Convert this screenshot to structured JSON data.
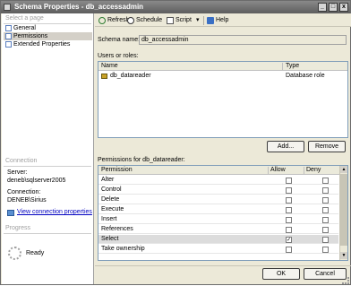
{
  "window": {
    "title": "Schema Properties - db_accessadmin",
    "minimize": "_",
    "maximize": "□",
    "close": "x"
  },
  "left": {
    "select_page_title": "Select a page",
    "pages": [
      {
        "label": "General"
      },
      {
        "label": "Permissions"
      },
      {
        "label": "Extended Properties"
      }
    ],
    "connection_title": "Connection",
    "server_label": "Server:",
    "server_value": "deneb\\sqlserver2005",
    "connection_label": "Connection:",
    "connection_value": "DENEB\\Sirius",
    "view_link": "View connection properties",
    "progress_title": "Progress",
    "status": "Ready"
  },
  "toolbar": {
    "refresh": "Refresh",
    "schedule": "Schedule",
    "script": "Script",
    "dropdown": "▾",
    "help": "Help"
  },
  "main": {
    "schema_name_label": "Schema name:",
    "schema_name_value": "db_accessadmin",
    "users_label": "Users or roles:",
    "users_columns": {
      "name": "Name",
      "type": "Type"
    },
    "users_rows": [
      {
        "name": "db_datareader",
        "type": "Database role"
      }
    ],
    "add_button": "Add...",
    "remove_button": "Remove",
    "permissions_label": "Permissions for db_datareader:",
    "perm_columns": {
      "permission": "Permission",
      "allow": "Allow",
      "deny": "Deny"
    },
    "permissions": [
      {
        "name": "Alter",
        "allow": false,
        "deny": false
      },
      {
        "name": "Control",
        "allow": false,
        "deny": false
      },
      {
        "name": "Delete",
        "allow": false,
        "deny": false
      },
      {
        "name": "Execute",
        "allow": false,
        "deny": false
      },
      {
        "name": "Insert",
        "allow": false,
        "deny": false
      },
      {
        "name": "References",
        "allow": false,
        "deny": false
      },
      {
        "name": "Select",
        "allow": true,
        "deny": false
      },
      {
        "name": "Take ownership",
        "allow": false,
        "deny": false
      }
    ],
    "ok_button": "OK",
    "cancel_button": "Cancel"
  },
  "colors": {
    "title_bar": "#6e6e6e",
    "link": "#0000c0",
    "selection": "#d4d0c8"
  }
}
